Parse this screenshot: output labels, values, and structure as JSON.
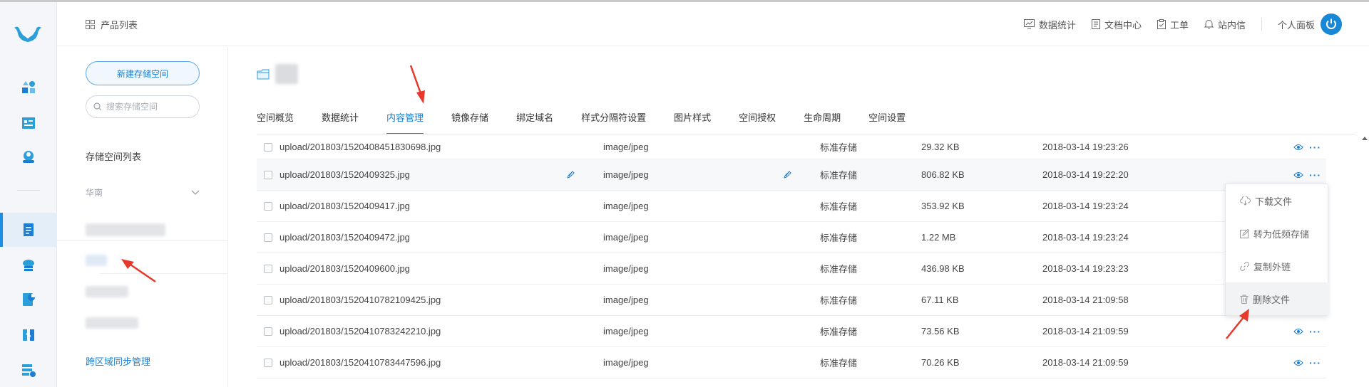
{
  "header": {
    "breadcrumb": "产品列表",
    "nav": [
      "数据统计",
      "文档中心",
      "工单",
      "站内信"
    ],
    "profile": "个人面板"
  },
  "panel": {
    "new_bucket": "新建存储空间",
    "search_placeholder": "搜索存储空间",
    "list_title": "存储空间列表",
    "region": "华南",
    "cross_region": "跨区域同步管理"
  },
  "tabs": [
    "空间概览",
    "数据统计",
    "内容管理",
    "镜像存储",
    "绑定域名",
    "样式分隔符设置",
    "图片样式",
    "空间授权",
    "生命周期",
    "空间设置"
  ],
  "active_tab": "内容管理",
  "files": [
    {
      "name": "upload/201803/1520408451830698.jpg",
      "type": "image/jpeg",
      "storage": "标准存储",
      "size": "29.32 KB",
      "time": "2018-03-14 19:23:26"
    },
    {
      "name": "upload/201803/1520409325.jpg",
      "type": "image/jpeg",
      "storage": "标准存储",
      "size": "806.82 KB",
      "time": "2018-03-14 19:22:20"
    },
    {
      "name": "upload/201803/1520409417.jpg",
      "type": "image/jpeg",
      "storage": "标准存储",
      "size": "353.92 KB",
      "time": "2018-03-14 19:23:24"
    },
    {
      "name": "upload/201803/1520409472.jpg",
      "type": "image/jpeg",
      "storage": "标准存储",
      "size": "1.22 MB",
      "time": "2018-03-14 19:23:24"
    },
    {
      "name": "upload/201803/1520409600.jpg",
      "type": "image/jpeg",
      "storage": "标准存储",
      "size": "436.98 KB",
      "time": "2018-03-14 19:23:23"
    },
    {
      "name": "upload/201803/1520410782109425.jpg",
      "type": "image/jpeg",
      "storage": "标准存储",
      "size": "67.11 KB",
      "time": "2018-03-14 21:09:58"
    },
    {
      "name": "upload/201803/1520410783242210.jpg",
      "type": "image/jpeg",
      "storage": "标准存储",
      "size": "73.56 KB",
      "time": "2018-03-14 21:09:59"
    },
    {
      "name": "upload/201803/1520410783447596.jpg",
      "type": "image/jpeg",
      "storage": "标准存储",
      "size": "70.26 KB",
      "time": "2018-03-14 21:09:59"
    }
  ],
  "menu": [
    "下载文件",
    "转为低频存储",
    "复制外链",
    "删除文件"
  ],
  "colors": {
    "accent": "#1a7fd4",
    "annotation": "#e8382c"
  }
}
